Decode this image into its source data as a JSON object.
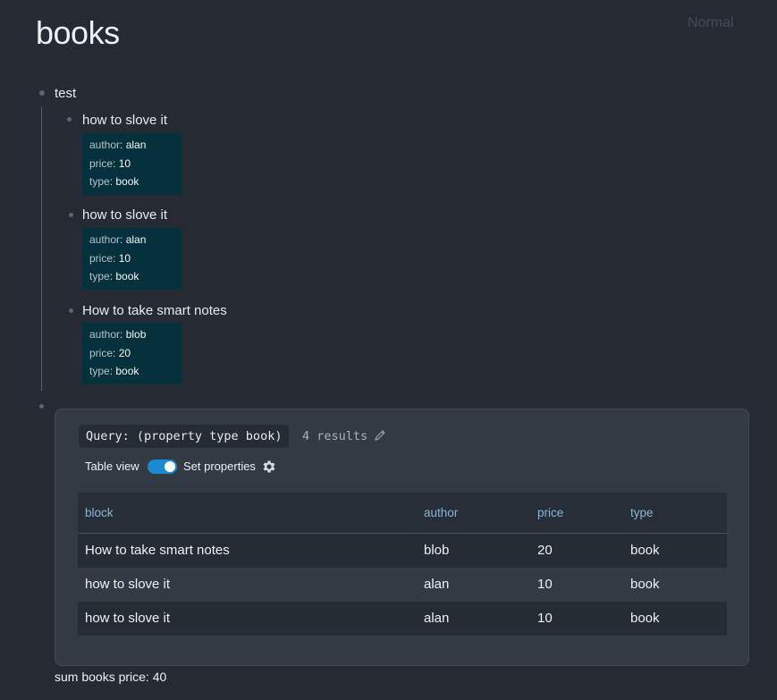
{
  "page": {
    "title": "books",
    "mode": "Normal"
  },
  "outline": {
    "root": "test",
    "children": [
      {
        "title": "how to slove it",
        "props": [
          {
            "key": "author",
            "value": "alan"
          },
          {
            "key": "price",
            "value": "10"
          },
          {
            "key": "type",
            "value": "book"
          }
        ]
      },
      {
        "title": "how to slove it",
        "props": [
          {
            "key": "author",
            "value": "alan"
          },
          {
            "key": "price",
            "value": "10"
          },
          {
            "key": "type",
            "value": "book"
          }
        ]
      },
      {
        "title": "How to take smart notes",
        "props": [
          {
            "key": "author",
            "value": "blob"
          },
          {
            "key": "price",
            "value": "20"
          },
          {
            "key": "type",
            "value": "book"
          }
        ]
      }
    ]
  },
  "query": {
    "label": "Query: (property type book)",
    "results": "4 results",
    "table_view_label": "Table view",
    "table_view_on": true,
    "set_properties_label": "Set properties",
    "columns": [
      "block",
      "author",
      "price",
      "type"
    ],
    "rows": [
      [
        "How to take smart notes",
        "blob",
        "20",
        "book"
      ],
      [
        "how to slove it",
        "alan",
        "10",
        "book"
      ],
      [
        "how to slove it",
        "alan",
        "10",
        "book"
      ]
    ]
  },
  "summary": "sum books price: 40",
  "colors": {
    "accent": "#1b8bd1",
    "property_bg": "#05313c",
    "header_text": "#88b5d6"
  }
}
